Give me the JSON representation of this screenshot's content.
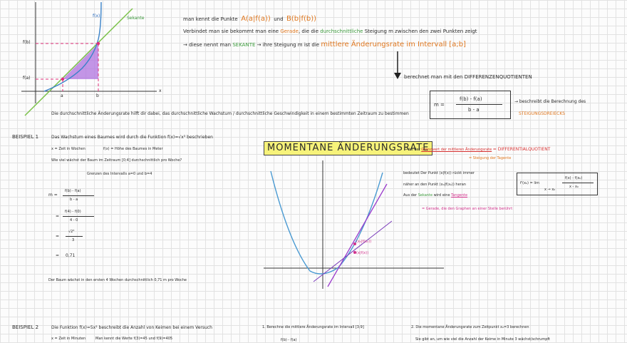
{
  "graph1": {
    "fx": "f(x)",
    "secant": "Sekante",
    "fb": "f(b)",
    "fa": "f(a)",
    "a": "a",
    "b": "b",
    "x": "x"
  },
  "intro": {
    "l1a": "man kennt die Punkte",
    "p1": "A(a|f(a))",
    "und": "und",
    "p2": "B(b|f(b))",
    "l2a": "Verbindet man sie bekommt man eine",
    "gerade": "Gerade",
    "l2b": ", die die",
    "durchschn": "durchschnittliche",
    "l2c": "Steigung m zwischen den zwei Punkten zeigt",
    "l3a": "→ diese nennt man",
    "sekante": "SEKANTE",
    "l3b": "→ ihre Steigung m ist die",
    "mar": "mittlere Änderungsrate im Intervall [a;b]",
    "l4": "berechnet man mit den DIFFERENZENQUOTIENTEN",
    "formula_m": "m =",
    "num": "f(b) - f(a)",
    "den": "b - a",
    "desc1": "→ beschreibt die Berechnung des",
    "desc2": "STEIGUNGSDREIECKS",
    "summary": "Die durchschnittliche Änderungsrate hilft dir dabei, das durchschnittliche Wachstum / durchschnittliche Geschwindigkeit in einem bestimmten Zeitraum zu bestimmen"
  },
  "b1": {
    "label": "BEISPIEL 1",
    "l1": "Das Wachstum eines Baumes wird durch die Funktion f(x)=√x³ beschrieben",
    "l2a": "x = Zeit in Wochen",
    "l2b": "f(x) = Höhe des Baumes in Meter",
    "l3": "Wie viel wächst der Baum im Zeitraum [0;4] durchschnittlich pro Woche?",
    "l4": "Grenzen des Intervalls a=0 und b=4",
    "s1": "m =",
    "s1n": "f(b) - f(a)",
    "s1d": "b - a",
    "s2": "=",
    "s2n": "f(4) - f(0)",
    "s2d": "4 - 0",
    "s3": "=",
    "s3n": "√2³",
    "s3d": "3",
    "s4": "=",
    "s4v": "0,71",
    "answer": "Der Baum wächst in den ersten 4 Wochen durchschnittlich 0,71 m pro Woche"
  },
  "moment": {
    "title": "MOMENTANE ÄNDERUNGSRATE",
    "l1a": "→ ist der",
    "grenz": "Grenzwert der mittleren Änderungsrate",
    "l1b": "= DIFFERENTIALQUOTIENT",
    "l2": "= Steigung der Tagente",
    "b1": "bedeutet Der Punkt (x|f(x)) rückt immer",
    "b2": "näher an den Punkt (x₀|f(x₀)) heran",
    "b3a": "Aus der",
    "sek": "Sekante",
    "b3b": "wird eine",
    "tang": "Tangente",
    "b4": "= Gerade, die den Graphen an einer Stelle berührt",
    "fp": "f'(x₀) = lim",
    "lim": "x → x₀",
    "fn": "f(x) - f(x₀)",
    "fd": "x - x₀",
    "pt1": "(x₀|f(x₀))",
    "pt2": "(x|f(x))"
  },
  "b2": {
    "label": "BEISPIEL 2",
    "l1": "Die Funktion f(x)=5x² beschreibt die Anzahl von Keimen bei einem Versuch",
    "l2a": "x = Zeit in Minuten",
    "l2b": "Man kennt die Werte f(3)=45 und f(9)=405",
    "q1": "1. Berechne die mittlere Änderungsrate im Intervall [3;9]",
    "q1b": "f(b) - f(a)",
    "q2": "2. Die momentane Änderungsrate zum Zeitpunkt x₀=3 berechnen",
    "q2b": "Sie gibt an, um wie viel die Anzahl der Keime in Minute 3 wächst/schrumpft"
  }
}
